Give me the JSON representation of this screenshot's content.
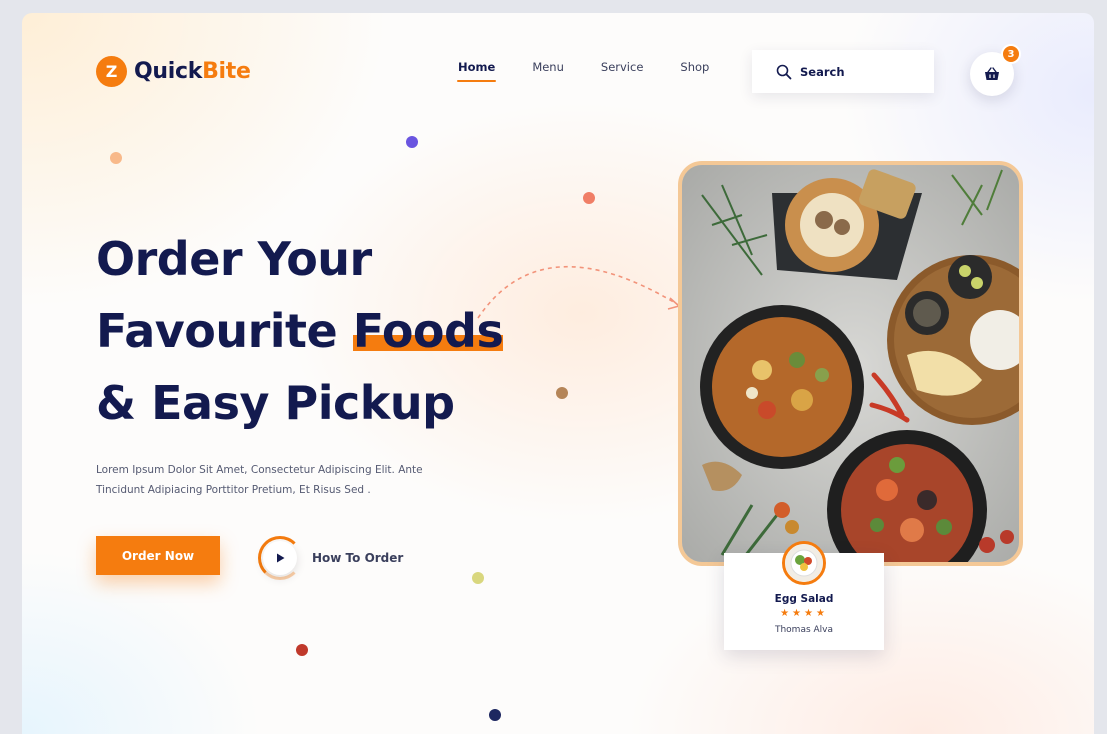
{
  "brand": {
    "badge": "Z",
    "name_part1": "Quick",
    "name_part2": "Bite"
  },
  "nav": {
    "items": [
      {
        "label": "Home",
        "active": true
      },
      {
        "label": "Menu",
        "active": false
      },
      {
        "label": "Service",
        "active": false
      },
      {
        "label": "Shop",
        "active": false
      }
    ]
  },
  "search": {
    "label": "Search"
  },
  "cart": {
    "count": "3"
  },
  "hero": {
    "line1": "Order Your",
    "line2_prefix": "Favourite",
    "line2_highlight": "Foods",
    "line3": "& Easy Pickup",
    "description": "Lorem Ipsum Dolor Sit Amet, Consectetur Adipiscing Elit. Ante Tincidunt Adipiacing Porttitor Pretium, Et Risus Sed .",
    "order_button": "Order Now",
    "how_to_order": "How To Order"
  },
  "review_card": {
    "dish": "Egg Salad",
    "stars": "★★★★",
    "rating": 4,
    "author": "Thomas Alva"
  },
  "colors": {
    "accent": "#f57c0f",
    "navy": "#131a4f"
  },
  "icons": [
    "search-icon",
    "basket-icon",
    "play-icon"
  ]
}
